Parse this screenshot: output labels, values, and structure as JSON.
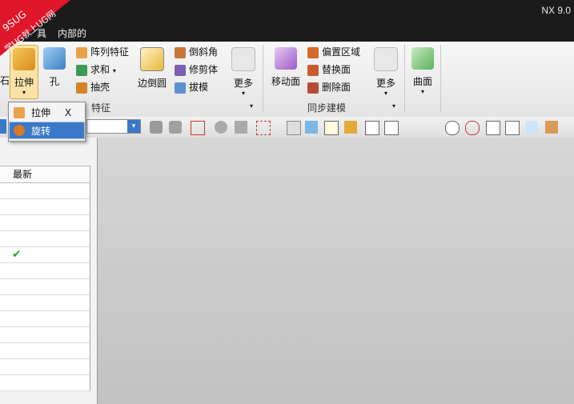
{
  "window": {
    "version": "NX 9.0"
  },
  "menu": {
    "partial_left": "置",
    "tools_partial": "具",
    "internal": "内部的"
  },
  "watermark": {
    "line1": "9SUG",
    "line2": "学UG就上UG网"
  },
  "ribbon": {
    "partial_left": "石",
    "extrude": "拉伸",
    "hole": "孔",
    "pattern_feature": "阵列特征",
    "unite": "求和",
    "shell": "抽壳",
    "edge_blend": "边倒圆",
    "chamfer": "倒斜角",
    "trim_body": "修剪体",
    "draft": "拔模",
    "more1": "更多",
    "move_face": "移动面",
    "offset_region": "偏置区域",
    "replace_face": "替换面",
    "delete_face": "删除面",
    "more2": "更多",
    "surface": "曲面",
    "group_feature": "特征",
    "group_sync": "同步建模"
  },
  "dropdown": {
    "extrude": "拉伸",
    "extrude_key": "X",
    "revolve": "旋转"
  },
  "panel": {
    "col_latest": "最新",
    "check": "✔"
  },
  "colors": {
    "accent": "#3a78c8",
    "check": "#2aa32a",
    "watermark": "#e0162b"
  }
}
